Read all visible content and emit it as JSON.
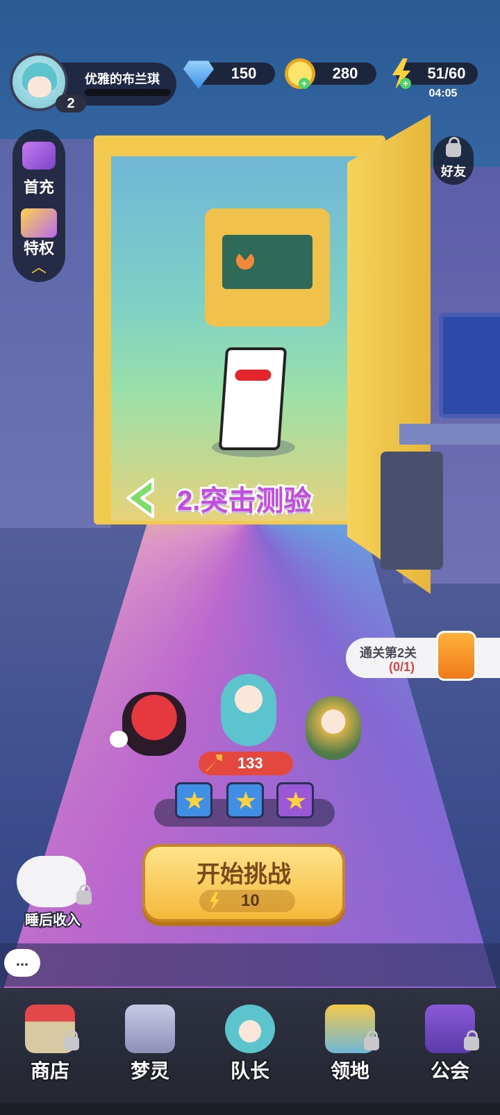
{
  "player": {
    "name": "优雅的布兰琪",
    "level": "2"
  },
  "resources": {
    "gems": "150",
    "coins": "280",
    "energy": "51/60",
    "energy_timer": "04:05"
  },
  "side_menu": {
    "first_recharge": "首充",
    "privilege": "特权"
  },
  "friends_label": "好友",
  "stage": {
    "title": "2.突击测验"
  },
  "quest": {
    "title": "通关第2关",
    "progress": "(0/1)"
  },
  "team_power": "133",
  "chests": [
    {
      "color": "#3f8fe6"
    },
    {
      "color": "#3f8fe6"
    },
    {
      "color": "#9a58d6"
    }
  ],
  "start_button": {
    "label": "开始挑战",
    "cost": "10"
  },
  "sleep_income": "睡后收入",
  "tabs": [
    {
      "label": "商店",
      "locked": true
    },
    {
      "label": "梦灵",
      "locked": false
    },
    {
      "label": "队长",
      "locked": false
    },
    {
      "label": "领地",
      "locked": true
    },
    {
      "label": "公会",
      "locked": true
    }
  ],
  "chat_icon": "..."
}
